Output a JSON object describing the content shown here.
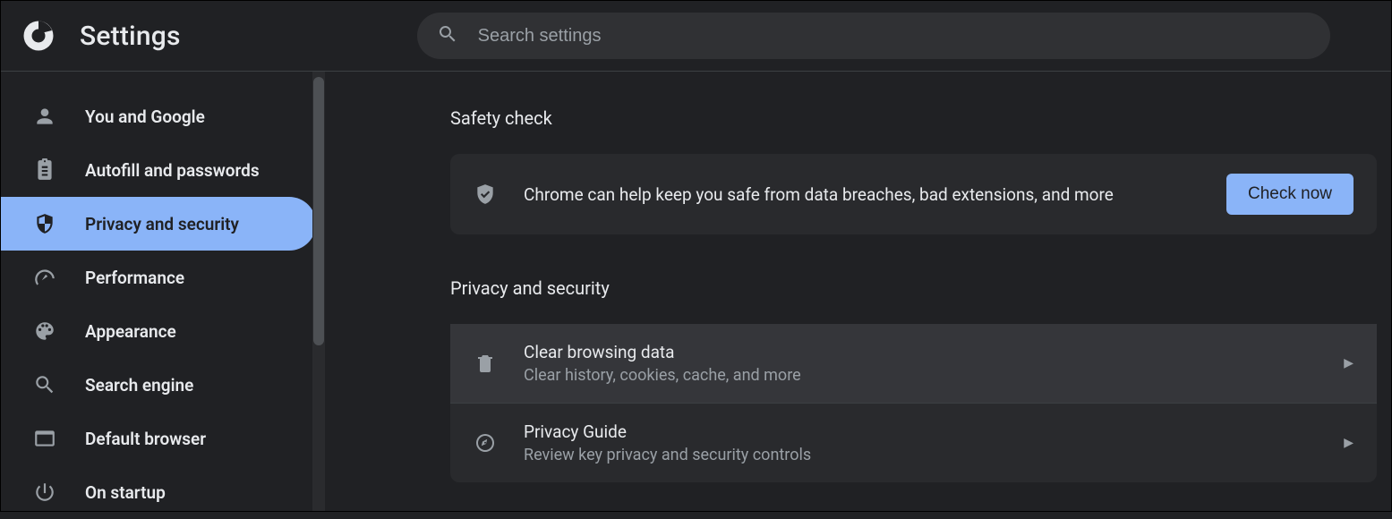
{
  "header": {
    "title": "Settings",
    "search_placeholder": "Search settings"
  },
  "sidebar": {
    "items": [
      {
        "id": "you-and-google",
        "label": "You and Google"
      },
      {
        "id": "autofill",
        "label": "Autofill and passwords"
      },
      {
        "id": "privacy",
        "label": "Privacy and security"
      },
      {
        "id": "performance",
        "label": "Performance"
      },
      {
        "id": "appearance",
        "label": "Appearance"
      },
      {
        "id": "search-engine",
        "label": "Search engine"
      },
      {
        "id": "default-browser",
        "label": "Default browser"
      },
      {
        "id": "on-startup",
        "label": "On startup"
      }
    ]
  },
  "main": {
    "safety_section_title": "Safety check",
    "safety_text": "Chrome can help keep you safe from data breaches, bad extensions, and more",
    "check_button": "Check now",
    "privacy_section_title": "Privacy and security",
    "items": [
      {
        "title": "Clear browsing data",
        "subtitle": "Clear history, cookies, cache, and more"
      },
      {
        "title": "Privacy Guide",
        "subtitle": "Review key privacy and security controls"
      }
    ]
  }
}
